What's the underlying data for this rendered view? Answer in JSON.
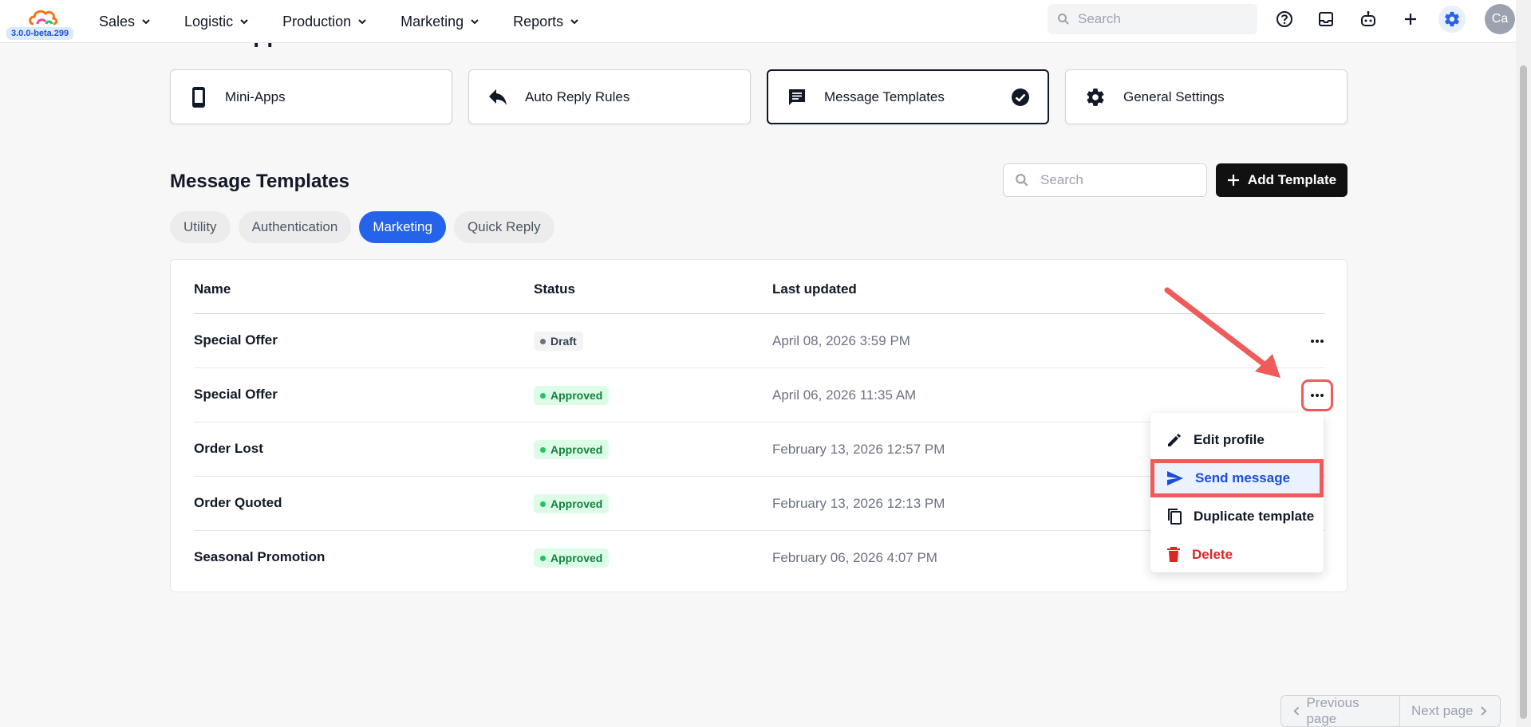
{
  "app": {
    "version": "3.0.0-beta.299"
  },
  "nav": {
    "items": [
      {
        "label": "Sales"
      },
      {
        "label": "Logistic"
      },
      {
        "label": "Production"
      },
      {
        "label": "Marketing"
      },
      {
        "label": "Reports"
      }
    ],
    "search_placeholder": "Search",
    "avatar_initials": "Ca"
  },
  "page": {
    "heading": "WhatsApp"
  },
  "sections": [
    {
      "label": "Mini-Apps",
      "icon": "phone-icon"
    },
    {
      "label": "Auto Reply Rules",
      "icon": "reply-icon"
    },
    {
      "label": "Message Templates",
      "icon": "message-icon",
      "active": true
    },
    {
      "label": "General Settings",
      "icon": "gear-icon"
    }
  ],
  "templates": {
    "title": "Message Templates",
    "search_placeholder": "Search",
    "add_button": "Add Template",
    "tabs": [
      {
        "label": "Utility"
      },
      {
        "label": "Authentication"
      },
      {
        "label": "Marketing",
        "active": true
      },
      {
        "label": "Quick Reply"
      }
    ],
    "columns": {
      "name": "Name",
      "status": "Status",
      "updated": "Last updated"
    },
    "rows": [
      {
        "name": "Special Offer",
        "status": "Draft",
        "updated": "April 08, 2026 3:59 PM"
      },
      {
        "name": "Special Offer",
        "status": "Approved",
        "updated": "April 06, 2026 11:35 AM"
      },
      {
        "name": "Order Lost",
        "status": "Approved",
        "updated": "February 13, 2026 12:57 PM"
      },
      {
        "name": "Order Quoted",
        "status": "Approved",
        "updated": "February 13, 2026 12:13 PM"
      },
      {
        "name": "Seasonal Promotion",
        "status": "Approved",
        "updated": "February 06, 2026 4:07 PM"
      }
    ]
  },
  "menu": {
    "edit": "Edit profile",
    "send": "Send message",
    "duplicate": "Duplicate template",
    "delete": "Delete"
  },
  "pagination": {
    "prev": "Previous page",
    "next": "Next page"
  },
  "colors": {
    "accent": "#2563eb",
    "highlight": "#ef5a5a",
    "danger": "#dc2626",
    "approved": "#15803d"
  }
}
